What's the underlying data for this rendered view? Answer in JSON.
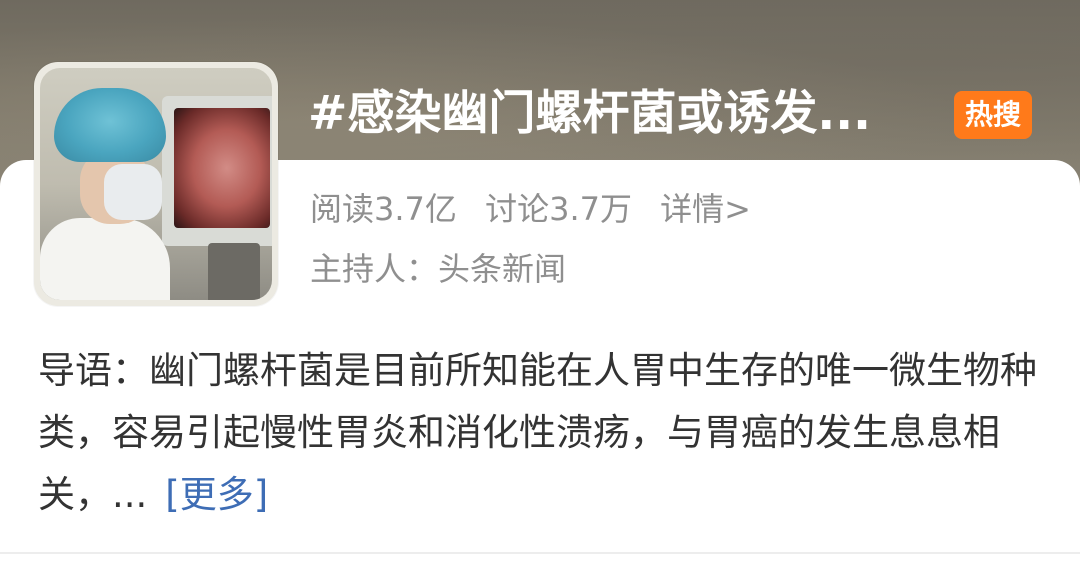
{
  "topic": {
    "title": "#感染幽门螺杆菌或诱发...",
    "badge": "热搜",
    "thumbnail_alt": "medical-endoscopy-photo"
  },
  "stats": {
    "reads": "阅读3.7亿",
    "discussions": "讨论3.7万",
    "details_link": "详情>"
  },
  "host": {
    "text": "主持人：头条新闻"
  },
  "intro": {
    "text": "导语：幽门螺杆菌是目前所知能在人胃中生存的唯一微生物种类，容易引起慢性胃炎和消化性溃疡，与胃癌的发生息息相关，...",
    "more_link": "[更多]"
  },
  "colors": {
    "badge_bg": "#ff7a1a",
    "link": "#3e6db5",
    "muted_text": "#8f8f8f",
    "body_text": "#333333",
    "header_bg": "#7a7467"
  }
}
